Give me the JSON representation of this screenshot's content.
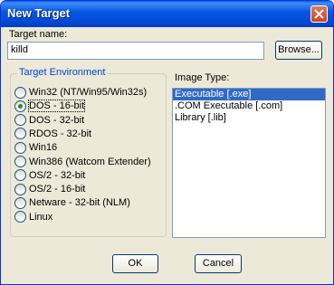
{
  "window": {
    "title": "New Target"
  },
  "target_name": {
    "label": "Target name:",
    "value": "killd",
    "browse_label": "Browse..."
  },
  "environment": {
    "title": "Target Environment",
    "selected": "DOS - 16-bit",
    "options": [
      "Win32 (NT/Win95/Win32s)",
      "DOS - 16-bit",
      "DOS - 32-bit",
      "RDOS - 32-bit",
      "Win16",
      "Win386 (Watcom Extender)",
      "OS/2 - 32-bit",
      "OS/2 - 16-bit",
      "Netware - 32-bit (NLM)",
      "Linux"
    ]
  },
  "image_type": {
    "label": "Image Type:",
    "selected": "Executable [.exe]",
    "items": [
      "Executable [.exe]",
      ".COM Executable [.com]",
      "Library [.lib]"
    ]
  },
  "buttons": {
    "ok": "OK",
    "cancel": "Cancel"
  }
}
